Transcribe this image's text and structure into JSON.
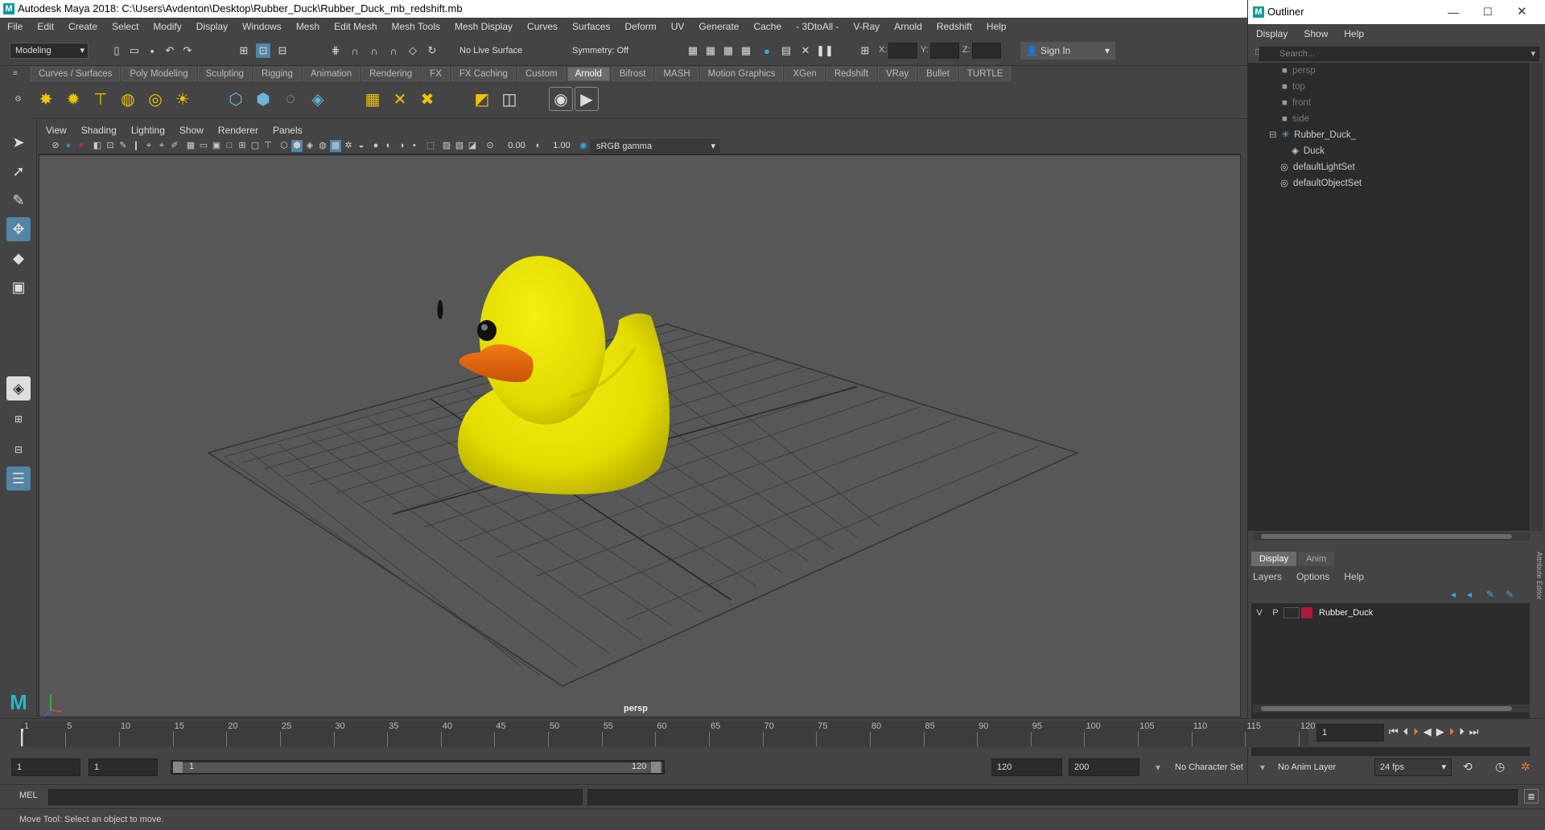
{
  "window": {
    "title": "Autodesk Maya 2018: C:\\Users\\Avdenton\\Desktop\\Rubber_Duck\\Rubber_Duck_mb_redshift.mb"
  },
  "menubar": [
    "File",
    "Edit",
    "Create",
    "Select",
    "Modify",
    "Display",
    "Windows",
    "Mesh",
    "Edit Mesh",
    "Mesh Tools",
    "Mesh Display",
    "Curves",
    "Surfaces",
    "Deform",
    "UV",
    "Generate",
    "Cache",
    "- 3DtoAll -",
    "V-Ray",
    "Arnold",
    "Redshift",
    "Help"
  ],
  "statusline": {
    "menuset": "Modeling",
    "live_surface": "No Live Surface",
    "symmetry": "Symmetry: Off",
    "x_label": "X:",
    "y_label": "Y:",
    "z_label": "Z:",
    "sign_in": "Sign In"
  },
  "shelf": {
    "tabs": [
      "Curves / Surfaces",
      "Poly Modeling",
      "Sculpting",
      "Rigging",
      "Animation",
      "Rendering",
      "FX",
      "FX Caching",
      "Custom",
      "Arnold",
      "Bifrost",
      "MASH",
      "Motion Graphics",
      "XGen",
      "Redshift",
      "VRay",
      "Bullet",
      "TURTLE"
    ],
    "active_tab": "Arnold"
  },
  "panel": {
    "menus": [
      "View",
      "Shading",
      "Lighting",
      "Show",
      "Renderer",
      "Panels"
    ],
    "exposure": "0.00",
    "gamma": "1.00",
    "colorspace": "sRGB gamma",
    "camera_label": "persp"
  },
  "outliner": {
    "title": "Outliner",
    "menus": [
      "Display",
      "Show",
      "Help"
    ],
    "search_placeholder": "Search...",
    "items": [
      {
        "label": "persp",
        "dim": true
      },
      {
        "label": "top",
        "dim": true
      },
      {
        "label": "front",
        "dim": true
      },
      {
        "label": "side",
        "dim": true
      },
      {
        "label": "Rubber_Duck_",
        "dim": false
      },
      {
        "label": "Duck",
        "dim": false
      },
      {
        "label": "defaultLightSet",
        "dim": false
      },
      {
        "label": "defaultObjectSet",
        "dim": false
      }
    ]
  },
  "layers": {
    "tabs": [
      "Display",
      "Anim"
    ],
    "active_tab": "Display",
    "menus": [
      "Layers",
      "Options",
      "Help"
    ],
    "layer": {
      "visible": "V",
      "playback": "P",
      "name": "Rubber_Duck",
      "color": "#b0183a"
    }
  },
  "timeline": {
    "ticks": [
      "1",
      "5",
      "10",
      "15",
      "20",
      "25",
      "30",
      "35",
      "40",
      "45",
      "50",
      "55",
      "60",
      "65",
      "70",
      "75",
      "80",
      "85",
      "90",
      "95",
      "100",
      "105",
      "110",
      "115",
      "120"
    ],
    "current_frame": "1"
  },
  "range": {
    "start": "1",
    "anim_start": "1",
    "slider_start": "1",
    "slider_end": "120",
    "end": "120",
    "anim_end": "200",
    "character_set": "No Character Set",
    "anim_layer": "No Anim Layer",
    "fps": "24 fps"
  },
  "command": {
    "lang": "MEL"
  },
  "help": {
    "text": "Move Tool: Select an object to move."
  },
  "side_tab": "Attribute Editor"
}
